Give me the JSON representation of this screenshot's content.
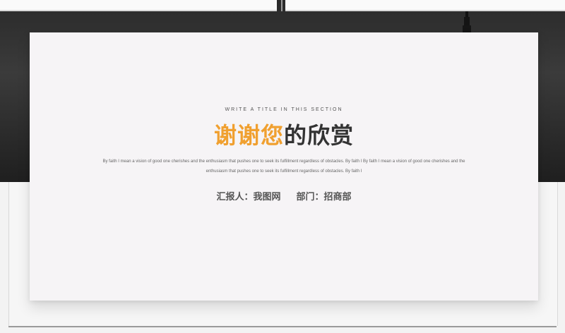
{
  "slide": {
    "eyebrow": "WRITE A TITLE IN THIS SECTION",
    "title_accent": "谢谢您",
    "title_rest": "的欣赏",
    "body": "By faith I mean a vision of good one cherishes and the enthusiasm that pushes one to seek its fulfillment regardless of obstacles. By faith I By faith I mean a vision of good one cherishes and the enthusiasm that pushes one to seek its fulfillment regardless of obstacles. By faith I",
    "reporter": "汇报人：我图网",
    "department": "部门：招商部"
  },
  "colors": {
    "accent": "#f0a030",
    "dark_text": "#333333",
    "card_bg": "#f6f4f6",
    "background_dark": "#2a2a2a"
  }
}
